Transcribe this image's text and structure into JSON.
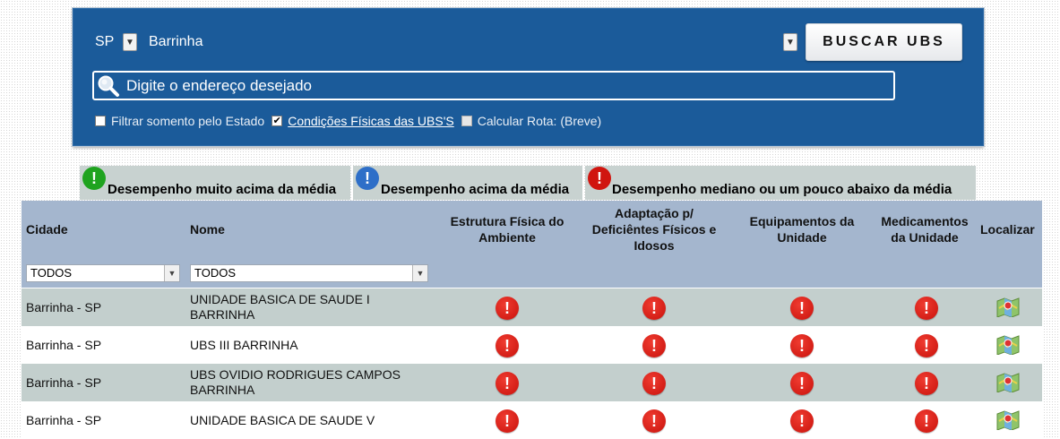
{
  "search_panel": {
    "state": "SP",
    "city": "Barrinha",
    "button_label": "BUSCAR UBS",
    "address_placeholder": "Digite o endereço desejado",
    "options": [
      {
        "label": "Filtrar somento pelo Estado",
        "checked": false
      },
      {
        "label": "Condições Físicas das UBS'S",
        "checked": true
      },
      {
        "label": "Calcular Rota: (Breve)",
        "checked": false,
        "disabled": true
      }
    ]
  },
  "legend": [
    {
      "label": "Desempenho muito acima da média",
      "color": "#1fa31f"
    },
    {
      "label": "Desempenho acima da média",
      "color": "#2e6fc8"
    },
    {
      "label": "Desempenho mediano ou um pouco abaixo da média",
      "color": "#d0150f"
    }
  ],
  "table": {
    "headers": {
      "cidade": "Cidade",
      "nome": "Nome",
      "estrutura": "Estrutura Física do Ambiente",
      "adaptacao": "Adaptação p/ Deficiêntes Físicos e Idosos",
      "equipamentos": "Equipamentos da Unidade",
      "medicamentos": "Medicamentos da Unidade",
      "localizar": "Localizar"
    },
    "filters": {
      "cidade": "TODOS",
      "nome": "TODOS"
    },
    "indicator_glyph": "!",
    "rows": [
      {
        "cidade": "Barrinha - SP",
        "nome": "UNIDADE BASICA DE SAUDE I BARRINHA",
        "status": "mediano"
      },
      {
        "cidade": "Barrinha - SP",
        "nome": "UBS III BARRINHA",
        "status": "mediano"
      },
      {
        "cidade": "Barrinha - SP",
        "nome": "UBS OVIDIO RODRIGUES CAMPOS BARRINHA",
        "status": "mediano"
      },
      {
        "cidade": "Barrinha - SP",
        "nome": "UNIDADE BASICA DE SAUDE V",
        "status": "mediano"
      }
    ]
  },
  "icons": {
    "search": "magnifier-icon",
    "locate": "map-icon",
    "status": "exclamation-icon"
  }
}
